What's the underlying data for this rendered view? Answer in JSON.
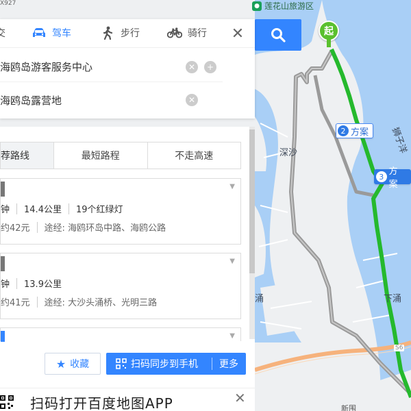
{
  "map": {
    "scenic_area": "莲花山旅游区",
    "road_code": "X927",
    "labels": {
      "shensha": "深沙",
      "shizi": "狮子洋",
      "xiayong": "下涌",
      "xinwei": "新围",
      "cun": "涌",
      "s6": "S6"
    },
    "start_label": "起",
    "plan_markers": [
      {
        "num": "2",
        "label": "方案"
      },
      {
        "num": "3",
        "label": "方案"
      }
    ],
    "colors": {
      "water": "#a9cff6",
      "land": "#eef0f2",
      "active_route": "#25b92d",
      "alt_route": "#9a9a9a",
      "highway": "#f6b27c"
    }
  },
  "modes": [
    {
      "label": "交",
      "icon": "bus-icon"
    },
    {
      "label": "驾车",
      "icon": "car-icon",
      "active": true
    },
    {
      "label": "步行",
      "icon": "walk-icon"
    },
    {
      "label": "骑行",
      "icon": "bike-icon"
    }
  ],
  "origin": "海鸥岛游客服务中心",
  "destination": "海鸥岛露营地",
  "tabs": [
    "荐路线",
    "最短路程",
    "不走高速"
  ],
  "plans": [
    {
      "duration": "钟",
      "distance": "14.4公里",
      "lights": "19个红绿灯",
      "cost": "约42元",
      "via_label": "途经:",
      "via": "海鸥环岛中路、海鸥公路"
    },
    {
      "duration": "钟",
      "distance": "13.9公里",
      "cost": "约41元",
      "via_label": "途经:",
      "via": "大沙头涌桥、光明三路"
    }
  ],
  "actions": {
    "favorite": "收藏",
    "scan_sync": "扫码同步到手机",
    "more": "更多"
  },
  "banner": {
    "text": "扫码打开百度地图APP"
  }
}
